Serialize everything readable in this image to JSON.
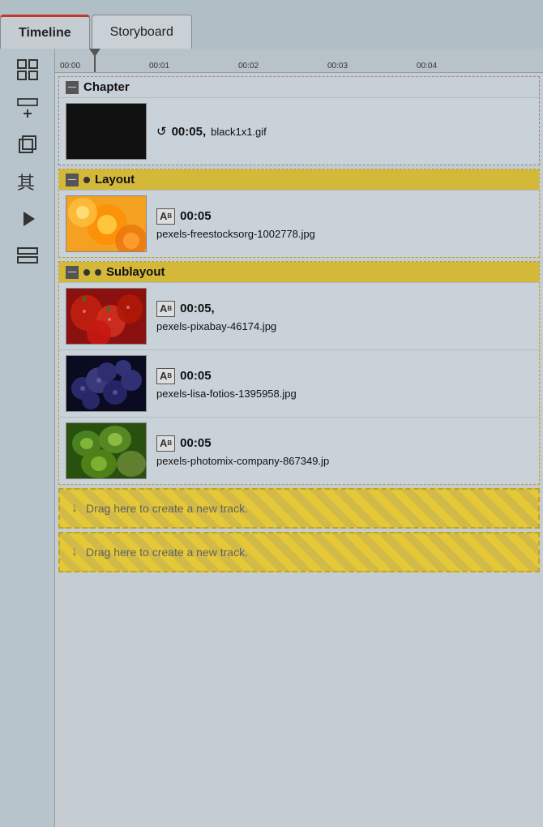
{
  "tabs": [
    {
      "id": "timeline",
      "label": "Timeline",
      "active": true
    },
    {
      "id": "storyboard",
      "label": "Storyboard",
      "active": false
    }
  ],
  "sidebar": {
    "icons": [
      {
        "name": "grid-icon",
        "symbol": "⊞"
      },
      {
        "name": "add-track-icon",
        "symbol": "⊕"
      },
      {
        "name": "copy-icon",
        "symbol": "❐"
      },
      {
        "name": "translation-icon",
        "symbol": "其"
      },
      {
        "name": "play-icon",
        "symbol": "▶"
      },
      {
        "name": "group-icon",
        "symbol": "⊟"
      }
    ]
  },
  "ruler": {
    "marks": [
      {
        "pos": 0,
        "label": "00:00"
      },
      {
        "pos": 110,
        "label": "00:01"
      },
      {
        "pos": 220,
        "label": "00:02"
      },
      {
        "pos": 330,
        "label": "00:03"
      },
      {
        "pos": 440,
        "label": "00:04"
      }
    ]
  },
  "sections": {
    "chapter": {
      "title": "Chapter",
      "track": {
        "duration": "00:05,",
        "filename": "black1x1.gif",
        "type": "gif"
      }
    },
    "layout": {
      "title": "Layout",
      "track": {
        "duration": "00:05",
        "filename": "pexels-freestocksorg-1002778.jpg",
        "type": "ab"
      }
    },
    "sublayout": {
      "title": "Sublayout",
      "tracks": [
        {
          "duration": "00:05,",
          "filename": "pexels-pixabay-46174.jpg",
          "type": "ab",
          "thumb": "strawberry"
        },
        {
          "duration": "00:05",
          "filename": "pexels-lisa-fotios-1395958.jpg",
          "type": "ab",
          "thumb": "blueberry"
        },
        {
          "duration": "00:05",
          "filename": "pexels-photomix-company-867349.jp",
          "type": "ab",
          "thumb": "kiwi"
        }
      ]
    }
  },
  "drag_zones": [
    {
      "text": "Drag here to create a new track."
    },
    {
      "text": "Drag here to create a new track."
    }
  ]
}
